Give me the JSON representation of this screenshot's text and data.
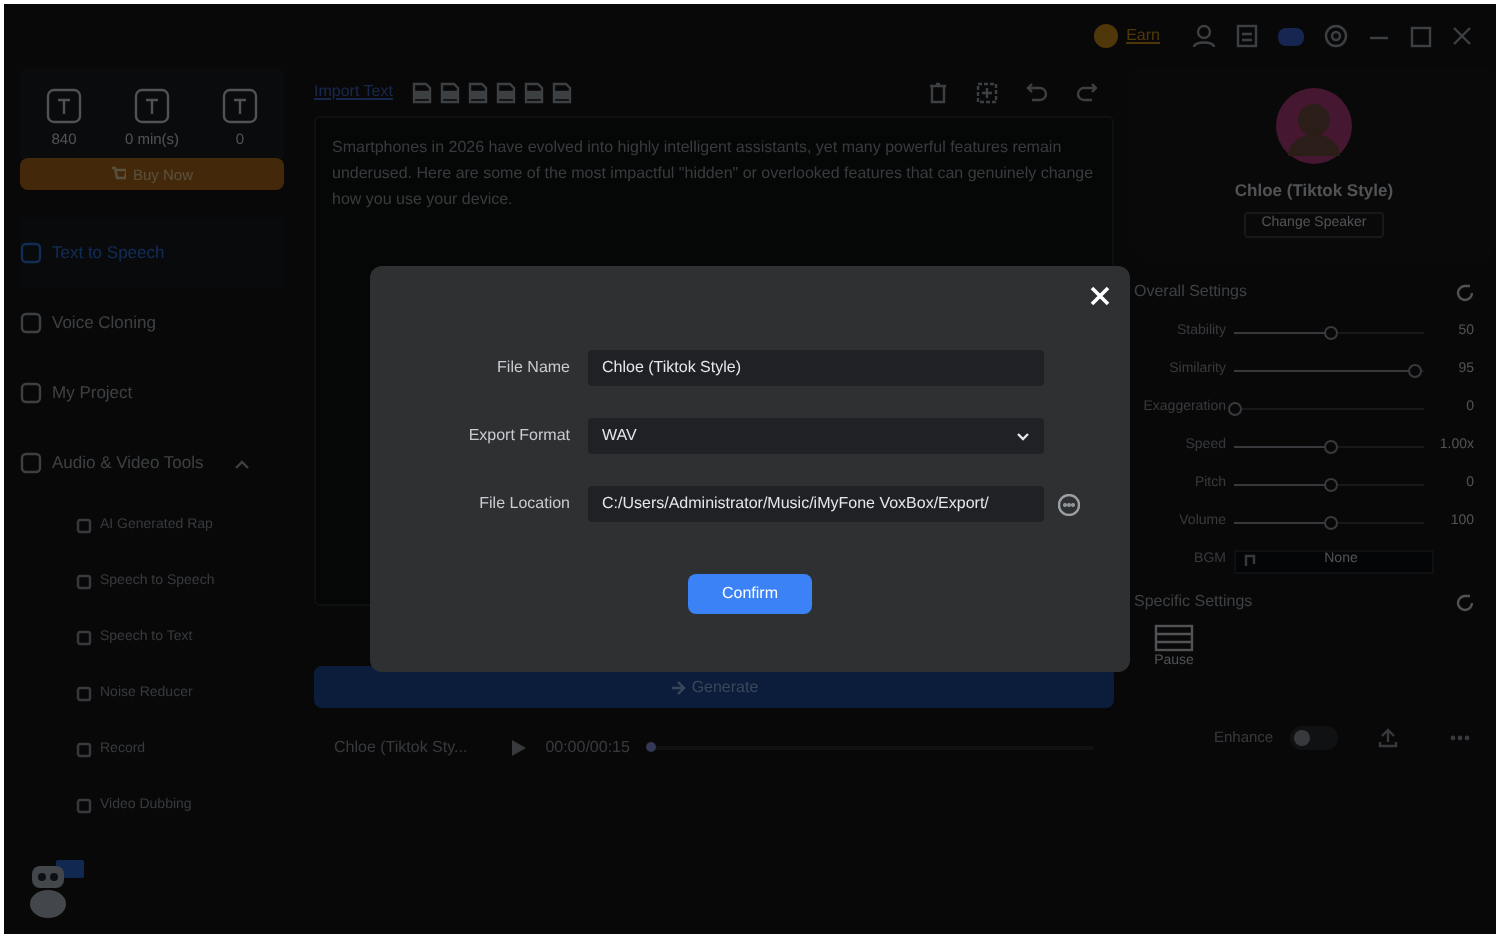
{
  "title_bar": {
    "earn": "Earn"
  },
  "sidebar": {
    "stats": [
      "840",
      "0 min(s)",
      "0"
    ],
    "buy_button": "Buy Now",
    "items": [
      {
        "label": "Text to Speech",
        "selected": true
      },
      {
        "label": "Voice Cloning",
        "selected": false
      },
      {
        "label": "My Project",
        "selected": false
      },
      {
        "label": "Audio & Video Tools",
        "selected": false,
        "expanded": true,
        "children": [
          {
            "label": "AI Generated Rap"
          },
          {
            "label": "Speech to Speech"
          },
          {
            "label": "Speech to Text"
          },
          {
            "label": "Noise Reducer"
          },
          {
            "label": "Record"
          },
          {
            "label": "Video Dubbing"
          }
        ]
      }
    ]
  },
  "editor": {
    "import_link": "Import Text",
    "text": "Smartphones in 2026 have evolved into highly intelligent assistants, yet many powerful features remain underused. Here are some of the most impactful \"hidden\" or overlooked features that can genuinely change how you use your device.",
    "generate_button": "Generate"
  },
  "player": {
    "title": "Chloe (Tiktok Sty...",
    "time": "00:00/00:15",
    "level": 0,
    "enhance_label": "Enhance",
    "enhance_on": false
  },
  "speaker": {
    "name": "Chloe (Tiktok Style)",
    "change_button": "Change Speaker"
  },
  "overall_settings": {
    "title": "Overall Settings",
    "sliders": [
      {
        "label": "Stability",
        "level": 0.5,
        "reading": "50"
      },
      {
        "label": "Similarity",
        "level": 0.95,
        "reading": "95"
      },
      {
        "label": "Exaggeration",
        "level": 0,
        "reading": "0"
      },
      {
        "label": "Speed",
        "level": 0.5,
        "reading": "1.00x"
      },
      {
        "label": "Pitch",
        "level": 0.5,
        "reading": "0"
      },
      {
        "label": "Volume",
        "level": 0.5,
        "reading": "100"
      }
    ],
    "bgm": {
      "label": "BGM",
      "value": "None"
    }
  },
  "specific_settings": {
    "title": "Specific Settings",
    "tools": [
      "Pause"
    ]
  },
  "dialog": {
    "fields": [
      {
        "kind": "text",
        "label": "File Name",
        "value": "Chloe (Tiktok Style)"
      },
      {
        "kind": "select",
        "label": "Export Format",
        "value": "WAV"
      },
      {
        "kind": "path",
        "label": "File Location",
        "value": "C:/Users/Administrator/Music/iMyFone VoxBox/Export/"
      }
    ],
    "confirm_button": "Confirm"
  }
}
